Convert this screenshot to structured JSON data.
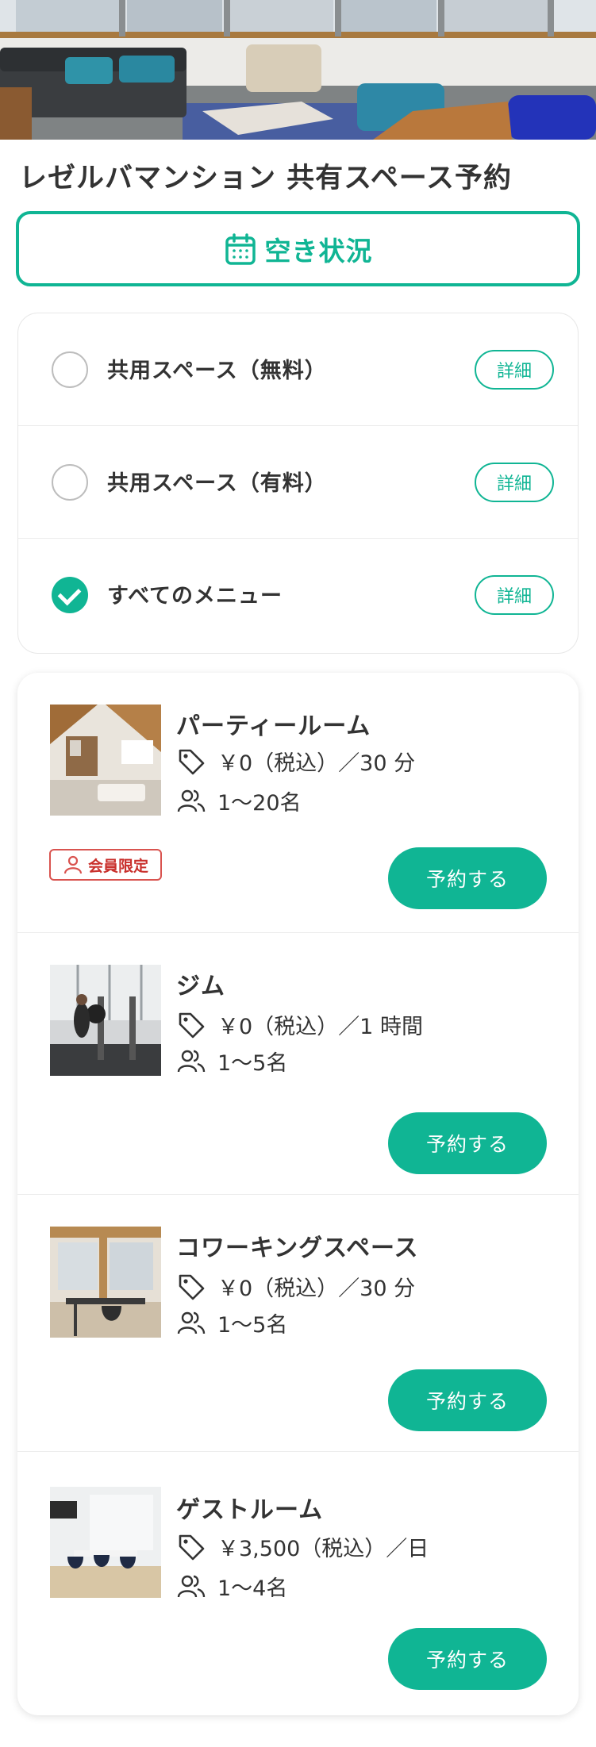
{
  "header": {
    "title": "レゼルバマンション 共有スペース予約"
  },
  "availability": {
    "label": "空き状況",
    "icon": "calendar-icon"
  },
  "filters": [
    {
      "label": "共用スペース（無料）",
      "selected": false,
      "detail_label": "詳細"
    },
    {
      "label": "共用スペース（有料）",
      "selected": false,
      "detail_label": "詳細"
    },
    {
      "label": "すべてのメニュー",
      "selected": true,
      "detail_label": "詳細"
    }
  ],
  "spaces": [
    {
      "name": "パーティールーム",
      "price": "￥0（税込）／30 分",
      "capacity": "1～20名",
      "members_only": true,
      "badge_label": "会員限定",
      "reserve_label": "予約する"
    },
    {
      "name": "ジム",
      "price": "￥0（税込）／1 時間",
      "capacity": "1～5名",
      "members_only": false,
      "reserve_label": "予約する"
    },
    {
      "name": "コワーキングスペース",
      "price": "￥0（税込）／30 分",
      "capacity": "1～5名",
      "members_only": false,
      "reserve_label": "予約する"
    },
    {
      "name": "ゲストルーム",
      "price": "￥3,500（税込）／日",
      "capacity": "1～4名",
      "members_only": false,
      "reserve_label": "予約する"
    }
  ],
  "colors": {
    "accent": "#10b594",
    "badge": "#d9534f",
    "text": "#333333"
  },
  "icons": {
    "price": "price-tag-icon",
    "capacity": "people-icon",
    "member": "person-icon",
    "check": "check-icon"
  }
}
